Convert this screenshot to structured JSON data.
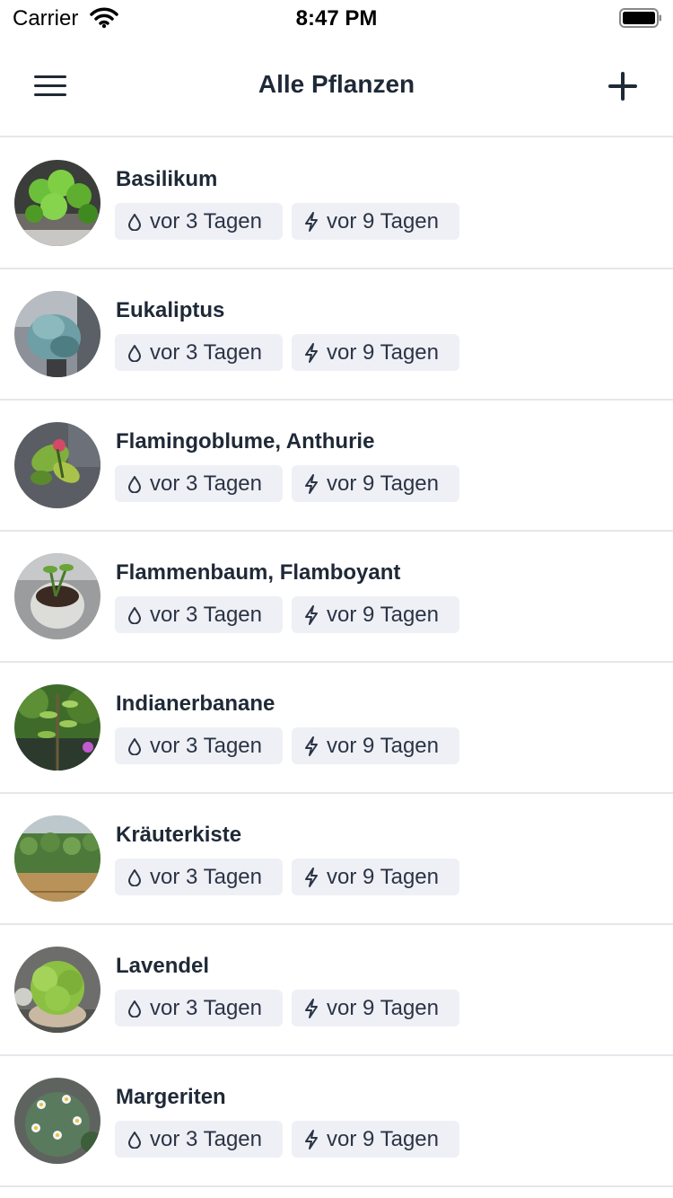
{
  "status_bar": {
    "carrier": "Carrier",
    "time": "8:47 PM",
    "icons": [
      "wifi-icon",
      "battery-icon"
    ]
  },
  "nav_bar": {
    "title": "Alle Pflanzen",
    "left_icon": "hamburger-menu-icon",
    "right_icon": "plus-icon"
  },
  "colors": {
    "text": "#1f2937",
    "divider": "#e5e7eb",
    "tag_background": "#eef0f6"
  },
  "plants": [
    {
      "name": "Basilikum",
      "watered": "vor 3 Tagen",
      "fertilized": "vor 9 Tagen",
      "photo": "basil"
    },
    {
      "name": "Eukaliptus",
      "watered": "vor 3 Tagen",
      "fertilized": "vor 9 Tagen",
      "photo": "eucalyptus"
    },
    {
      "name": "Flamingoblume, Anthurie",
      "watered": "vor 3 Tagen",
      "fertilized": "vor 9 Tagen",
      "photo": "anthurium"
    },
    {
      "name": "Flammenbaum, Flamboyant",
      "watered": "vor 3 Tagen",
      "fertilized": "vor 9 Tagen",
      "photo": "flamboyant"
    },
    {
      "name": "Indianerbanane",
      "watered": "vor 3 Tagen",
      "fertilized": "vor 9 Tagen",
      "photo": "pawpaw"
    },
    {
      "name": "Kräuterkiste",
      "watered": "vor 3 Tagen",
      "fertilized": "vor 9 Tagen",
      "photo": "herb-box"
    },
    {
      "name": "Lavendel",
      "watered": "vor 3 Tagen",
      "fertilized": "vor 9 Tagen",
      "photo": "lavender"
    },
    {
      "name": "Margeriten",
      "watered": "vor 3 Tagen",
      "fertilized": "vor 9 Tagen",
      "photo": "daisies"
    }
  ]
}
